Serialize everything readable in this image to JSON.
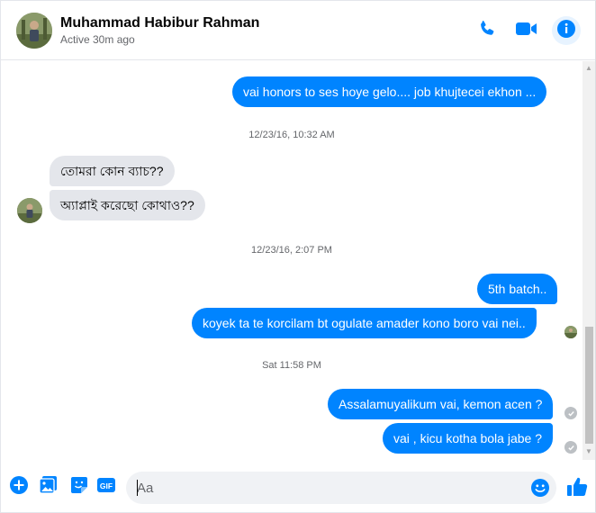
{
  "header": {
    "name": "Muhammad Habibur Rahman",
    "status": "Active 30m ago"
  },
  "colors": {
    "accent": "#0084ff",
    "incoming_bubble": "#e4e6eb",
    "muted_text": "#65676b"
  },
  "messages": [
    {
      "kind": "out",
      "text": "vai honors to ses hoye gelo.... job khujtecei ekhon ..."
    },
    {
      "kind": "timestamp",
      "text": "12/23/16, 10:32 AM"
    },
    {
      "kind": "in",
      "text": "তোমরা কোন ব্যাচ??"
    },
    {
      "kind": "in",
      "text": "অ্যাপ্লাই করেছো কোথাও??"
    },
    {
      "kind": "timestamp",
      "text": "12/23/16, 2:07 PM"
    },
    {
      "kind": "out",
      "text": "5th batch.."
    },
    {
      "kind": "out",
      "text": "koyek ta te korcilam bt ogulate amader kono boro vai nei.."
    },
    {
      "kind": "timestamp",
      "text": "Sat 11:58 PM"
    },
    {
      "kind": "out",
      "text": "Assalamuyalikum vai, kemon acen ?"
    },
    {
      "kind": "out",
      "text": "vai , kicu kotha bola jabe ?"
    }
  ],
  "composer": {
    "placeholder": "Aa"
  },
  "icons": {
    "header": [
      "phone-icon",
      "video-camera-icon",
      "info-icon"
    ],
    "composer": [
      "plus-icon",
      "photo-icon",
      "sticker-icon",
      "gif-icon",
      "emoji-icon",
      "thumbs-up-icon"
    ]
  }
}
